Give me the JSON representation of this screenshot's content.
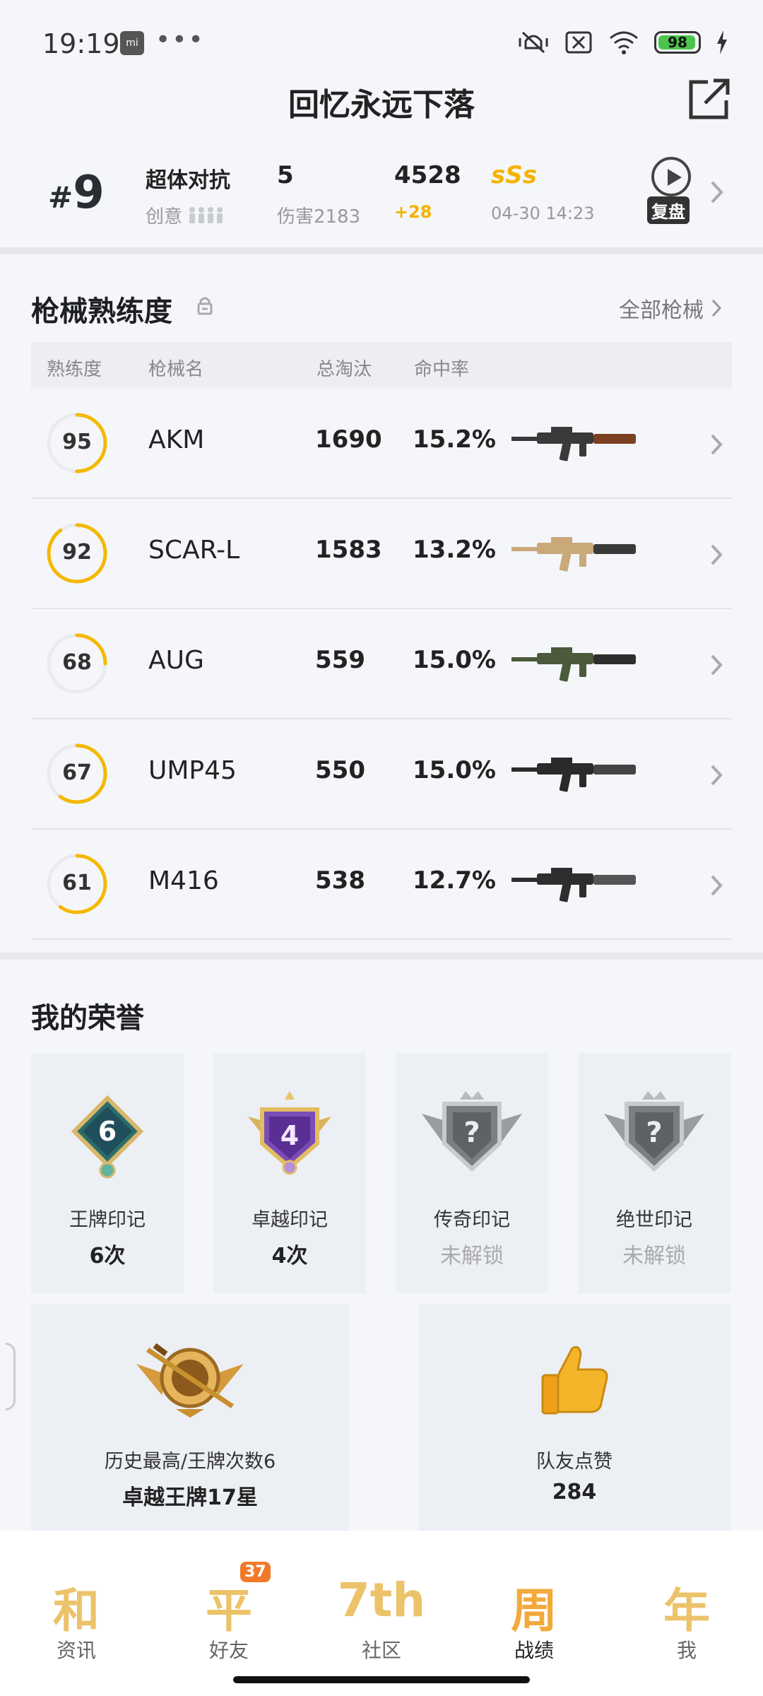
{
  "status_bar": {
    "time": "19:19",
    "app_icon": "mi",
    "dots": "•••",
    "battery": "98"
  },
  "header": {
    "title": "回忆永远下落"
  },
  "match": {
    "rank_hash": "#",
    "rank": "9",
    "mode": "超体对抗",
    "sub": "创意",
    "kills": "5",
    "damage": "伤害2183",
    "score": "4528",
    "score_delta": "+28",
    "grade": "sSs",
    "date": "04-30 14:23",
    "replay_label": "复盘"
  },
  "weapons": {
    "title": "枪械熟练度",
    "all_link": "全部枪械",
    "headers": {
      "proficiency": "熟练度",
      "name": "枪械名",
      "kills": "总淘汰",
      "accuracy": "命中率"
    },
    "rows": [
      {
        "proficiency": "95",
        "name": "AKM",
        "kills": "1690",
        "accuracy": "15.2%",
        "ring": 0.5
      },
      {
        "proficiency": "92",
        "name": "SCAR-L",
        "kills": "1583",
        "accuracy": "13.2%",
        "ring": 0.9
      },
      {
        "proficiency": "68",
        "name": "AUG",
        "kills": "559",
        "accuracy": "15.0%",
        "ring": 0.25
      },
      {
        "proficiency": "67",
        "name": "UMP45",
        "kills": "550",
        "accuracy": "15.0%",
        "ring": 0.6
      },
      {
        "proficiency": "61",
        "name": "M416",
        "kills": "538",
        "accuracy": "12.7%",
        "ring": 0.6
      }
    ]
  },
  "honors": {
    "title": "我的荣誉",
    "cards": [
      {
        "label": "王牌印记",
        "count": "6次",
        "badge_num": "6"
      },
      {
        "label": "卓越印记",
        "count": "4次",
        "badge_num": "4"
      },
      {
        "label": "传奇印记",
        "count": "未解锁",
        "badge_num": "?"
      },
      {
        "label": "绝世印记",
        "count": "未解锁",
        "badge_num": "?"
      }
    ],
    "history": {
      "label": "历史最高/王牌次数6",
      "value": "卓越王牌17星"
    },
    "likes": {
      "label": "队友点赞",
      "value": "284"
    }
  },
  "nav": {
    "items": [
      {
        "glyph": "和",
        "label": "资讯"
      },
      {
        "glyph": "平",
        "label": "好友",
        "badge": "37"
      },
      {
        "glyph": "7th",
        "label": "社区"
      },
      {
        "glyph": "周",
        "label": "战绩"
      },
      {
        "glyph": "年",
        "label": "我"
      }
    ]
  },
  "colors": {
    "accent": "#f5b800",
    "ring_track": "#e9ebef",
    "background": "#f4f6fa"
  }
}
